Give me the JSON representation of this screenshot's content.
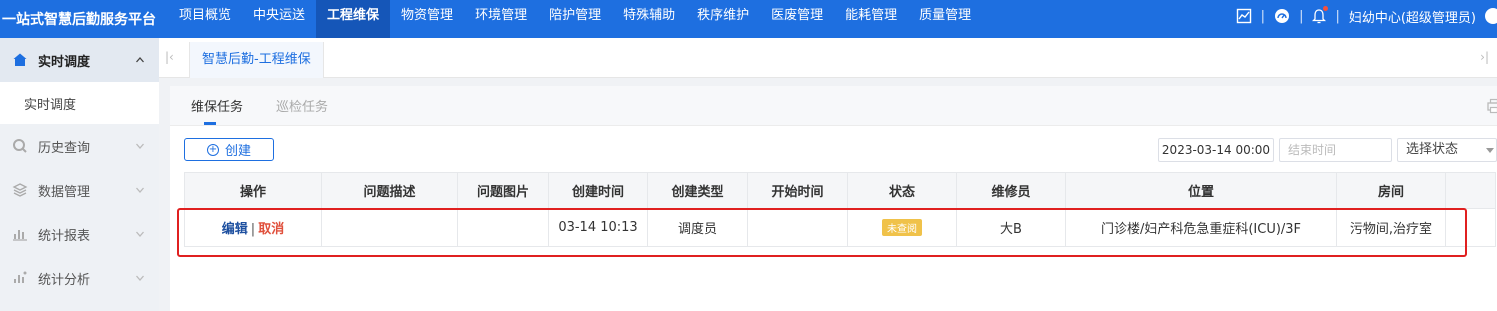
{
  "app": {
    "title": "一站式智慧后勤服务平台"
  },
  "topnav": [
    {
      "label": "项目概览",
      "active": false
    },
    {
      "label": "中央运送",
      "active": false
    },
    {
      "label": "工程维保",
      "active": true
    },
    {
      "label": "物资管理",
      "active": false
    },
    {
      "label": "环境管理",
      "active": false
    },
    {
      "label": "陪护管理",
      "active": false
    },
    {
      "label": "特殊辅助",
      "active": false
    },
    {
      "label": "秩序维护",
      "active": false
    },
    {
      "label": "医废管理",
      "active": false
    },
    {
      "label": "能耗管理",
      "active": false
    },
    {
      "label": "质量管理",
      "active": false
    }
  ],
  "header_right": {
    "user": "妇幼中心(超级管理员)",
    "icons": [
      "chart-icon",
      "dashboard-icon",
      "bell-icon",
      "avatar"
    ]
  },
  "sidebar": {
    "items": [
      {
        "label": "实时调度",
        "icon": "home-icon",
        "expanded": true
      },
      {
        "label": "历史查询",
        "icon": "history-icon",
        "expanded": false
      },
      {
        "label": "数据管理",
        "icon": "layers-icon",
        "expanded": false
      },
      {
        "label": "统计报表",
        "icon": "bar-chart-icon",
        "expanded": false
      },
      {
        "label": "统计分析",
        "icon": "analysis-icon",
        "expanded": false
      }
    ],
    "sub_items": [
      {
        "label": "实时调度"
      }
    ]
  },
  "page_tabs": [
    {
      "label": "智慧后勤-工程维保"
    }
  ],
  "subtabs": [
    {
      "label": "维保任务",
      "active": true
    },
    {
      "label": "巡检任务",
      "active": false
    }
  ],
  "toolbar": {
    "create_label": "创建",
    "date_start_value": "2023-03-14 00:00",
    "date_end_placeholder": "结束时间",
    "status_placeholder": "选择状态"
  },
  "table": {
    "columns": [
      "操作",
      "问题描述",
      "问题图片",
      "创建时间",
      "创建类型",
      "开始时间",
      "状态",
      "维修员",
      "位置",
      "房间"
    ],
    "rows": [
      {
        "op_edit": "编辑",
        "op_sep": "|",
        "op_cancel": "取消",
        "desc": "",
        "image": "",
        "created_at": "03-14 10:13",
        "create_type": "调度员",
        "start_time": "",
        "status": "未查阅",
        "repairer": "大B",
        "location": "门诊楼/妇产科危急重症科(ICU)/3F",
        "room": "污物间,治疗室"
      }
    ]
  },
  "colors": {
    "primary": "#1e6fe0",
    "highlight": "#e02020",
    "status_badge": "#f0c24a",
    "cancel": "#e0503c"
  }
}
